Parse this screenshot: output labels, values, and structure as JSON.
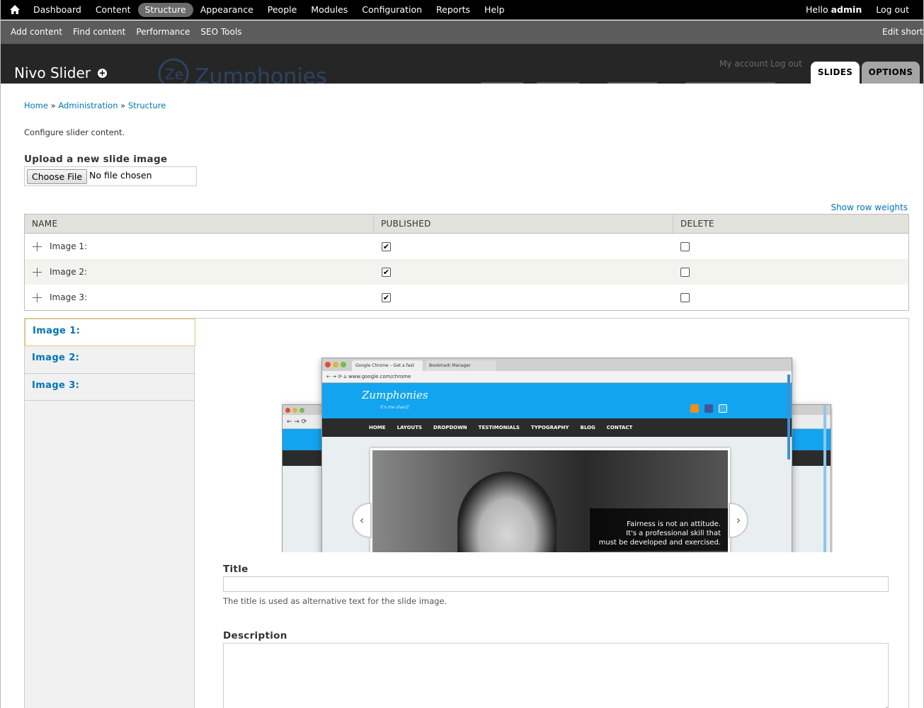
{
  "toolbar": {
    "menu": [
      "Dashboard",
      "Content",
      "Structure",
      "Appearance",
      "People",
      "Modules",
      "Configuration",
      "Reports",
      "Help"
    ],
    "active": "Structure",
    "hello": "Hello ",
    "user": "admin",
    "logout": "Log out"
  },
  "shortcuts": {
    "links": [
      "Add content",
      "Find content",
      "Performance",
      "SEO Tools"
    ],
    "edit": "Edit shortcuts"
  },
  "header": {
    "title": "Nivo Slider",
    "add_icon": "+",
    "my_account": "My account",
    "log_out": "Log out",
    "tabs": [
      "SLIDES",
      "OPTIONS"
    ]
  },
  "breadcrumb": [
    "Home",
    "Administration",
    "Structure"
  ],
  "breadcrumb_sep": "»",
  "intro": "Configure slider content.",
  "upload": {
    "label": "Upload a new slide image",
    "button": "Choose File",
    "status": "No file chosen"
  },
  "show_row_weights": "Show row weights",
  "table": {
    "headers": [
      "NAME",
      "PUBLISHED",
      "DELETE"
    ],
    "rows": [
      {
        "name": "Image 1:",
        "published": true,
        "delete": false
      },
      {
        "name": "Image 2:",
        "published": true,
        "delete": false
      },
      {
        "name": "Image 3:",
        "published": true,
        "delete": false
      }
    ]
  },
  "vertical_tabs": [
    "Image 1:",
    "Image 2:",
    "Image 3:"
  ],
  "preview": {
    "tab1": "Google Chrome – Get a fast",
    "tab2": "Bookmark Manager",
    "url": "www.google.com/chrome",
    "brand": "Zumphonies",
    "brand_tag": "It's me shanZ",
    "nav": [
      "HOME",
      "LAYOUTS",
      "DROPDOWN",
      "TESTIMONIALS",
      "TYPOGRAPHY",
      "BLOG",
      "CONTACT"
    ],
    "caption": [
      "Fairness is not an attitude.",
      "It's a professional skill that",
      "must be developed and exercised."
    ]
  },
  "fields": {
    "title_label": "Title",
    "title_help": "The title is used as alternative text for the slide image.",
    "description_label": "Description"
  }
}
